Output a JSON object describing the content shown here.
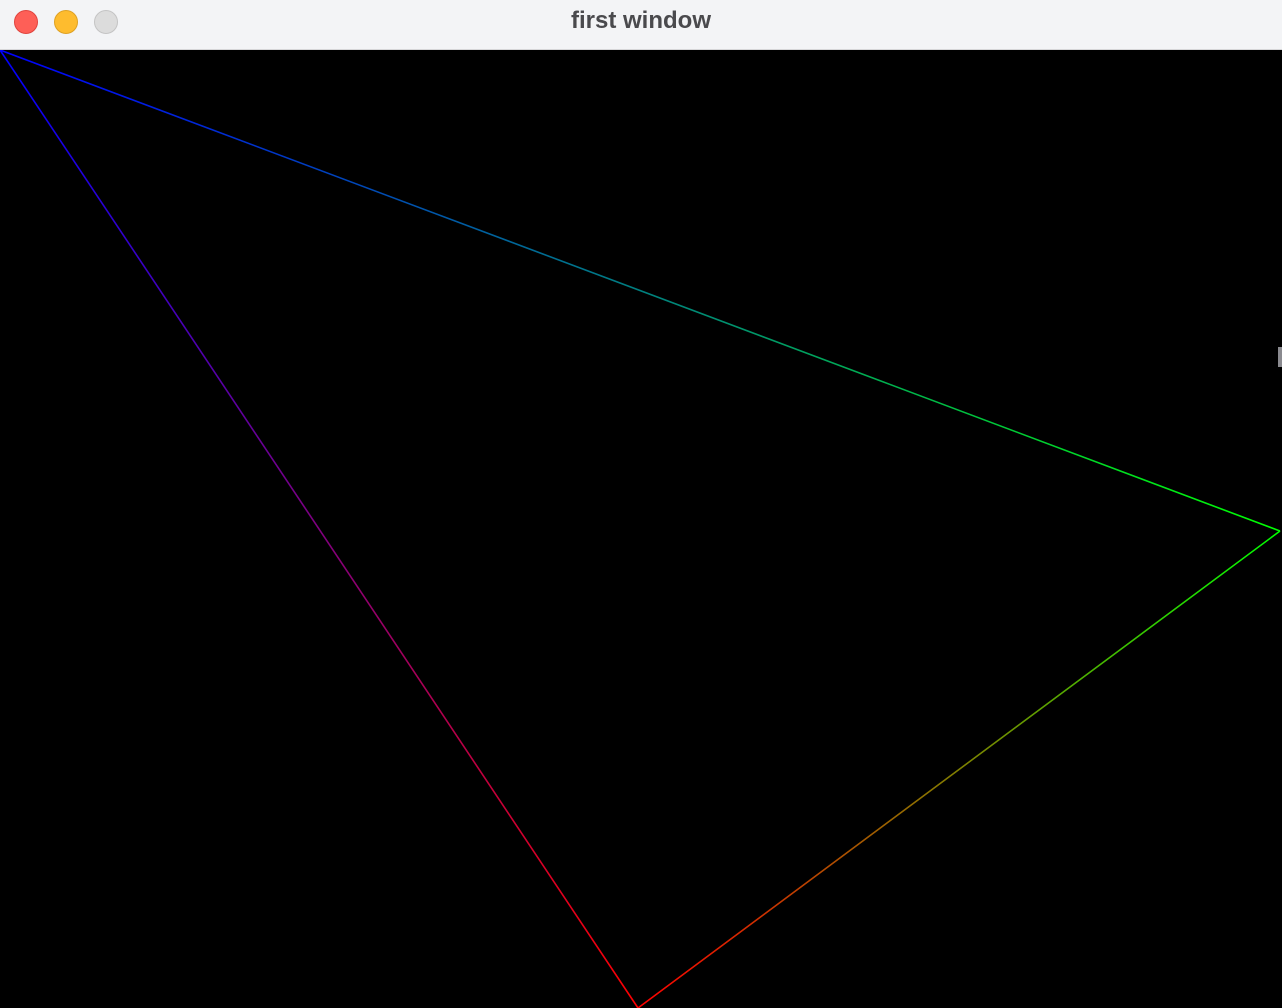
{
  "window": {
    "title": "first window"
  },
  "triangle": {
    "colors": [
      "#0000ff",
      "#00ff00",
      "#ff0000"
    ]
  }
}
